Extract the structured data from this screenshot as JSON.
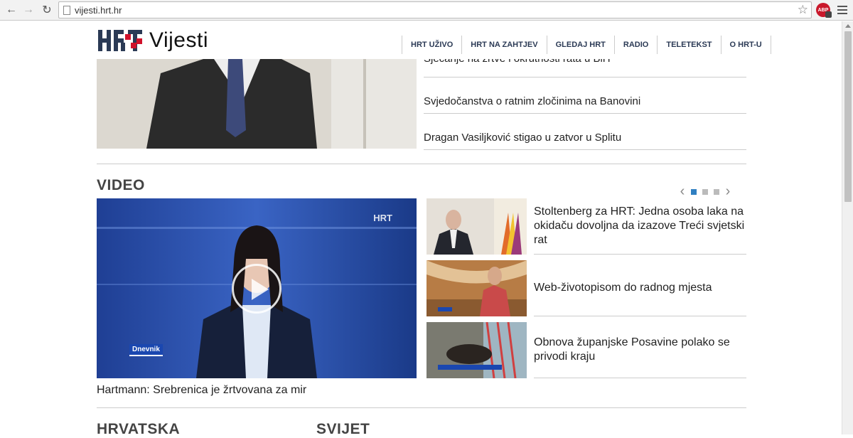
{
  "browser": {
    "url": "vijesti.hrt.hr",
    "back_icon": "back-arrow-icon",
    "forward_icon": "forward-arrow-icon",
    "reload_icon": "reload-icon",
    "bookmark_icon": "star-icon",
    "adblock_label": "ABP"
  },
  "header": {
    "logo_text": "Vijesti",
    "nav": [
      "HRT UŽIVO",
      "HRT NA ZAHTJEV",
      "GLEDAJ HRT",
      "RADIO",
      "TELETEKST",
      "O HRT-U"
    ]
  },
  "top_stories": [
    "Sjećanje na žrtve i okrutnosti rata u BiH",
    "Svjedočanstva o ratnim zločinima na Banovini",
    "Dragan Vasiljković stigao u zatvor u Splitu"
  ],
  "video_section": {
    "title": "VIDEO",
    "main": {
      "caption": "Hartmann: Srebrenica je žrtvovana za mir",
      "tag": "Dnevnik",
      "watermark": "HRT"
    },
    "carousel": {
      "pages": 3,
      "active": 1
    },
    "items": [
      "Stoltenberg za HRT: Jedna osoba laka na okidaču dovoljna da izazove Treći svjetski rat",
      "Web-životopisom do radnog mjesta",
      "Obnova županjske Posavine polako se privodi kraju"
    ]
  },
  "sections": {
    "left": "HRVATSKA",
    "right": "SVIJET"
  },
  "colors": {
    "nav_text": "#2b3a55",
    "carousel_active": "#2f7fc1",
    "logo_red": "#d0112b"
  }
}
